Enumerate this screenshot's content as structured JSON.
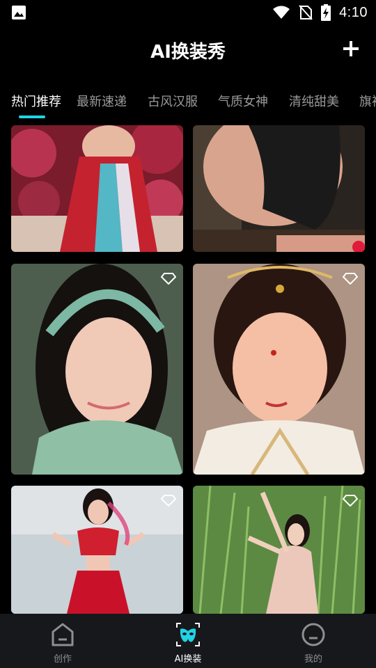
{
  "status_bar": {
    "time": "4:10",
    "icons": [
      "image-icon",
      "wifi-icon",
      "no-sim-icon",
      "battery-charging-icon"
    ]
  },
  "header": {
    "title": "AI换装秀",
    "add_icon": "plus-icon"
  },
  "tabs": [
    {
      "label": "热门推荐",
      "active": true
    },
    {
      "label": "最新速递",
      "active": false
    },
    {
      "label": "古风汉服",
      "active": false
    },
    {
      "label": "气质女神",
      "active": false
    },
    {
      "label": "清纯甜美",
      "active": false
    },
    {
      "label": "旗袍",
      "active": false
    }
  ],
  "colors": {
    "accent": "#21d3e6",
    "background": "#000000",
    "nav_background": "#17181c"
  },
  "cards": [
    {
      "name": "card-red-dancer",
      "premium": false
    },
    {
      "name": "card-black-top",
      "premium": false
    },
    {
      "name": "card-green-headband",
      "premium": true
    },
    {
      "name": "card-veil-bride",
      "premium": true
    },
    {
      "name": "card-red-belly-dancer",
      "premium": true
    },
    {
      "name": "card-grass-dancer",
      "premium": true
    }
  ],
  "bottom_nav": [
    {
      "label": "创作",
      "icon": "home-icon",
      "active": false
    },
    {
      "label": "AI换装",
      "icon": "mask-icon",
      "active": true
    },
    {
      "label": "我的",
      "icon": "profile-icon",
      "active": false
    }
  ]
}
